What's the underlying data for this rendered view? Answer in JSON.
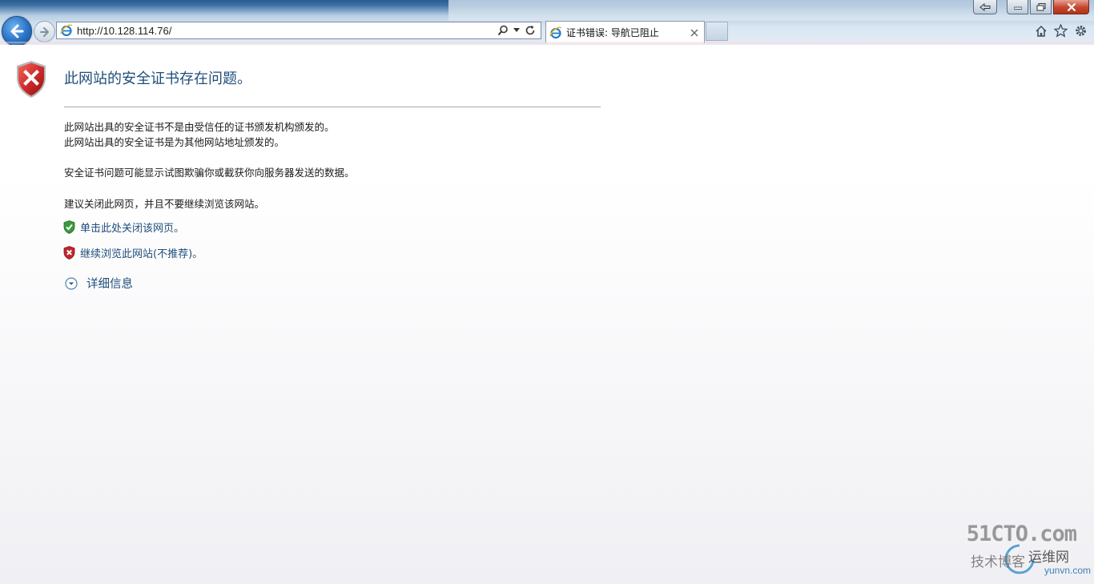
{
  "browser": {
    "address_bar": {
      "url": "http://10.128.114.76/"
    },
    "tab": {
      "title": "证书错误: 导航已阻止"
    },
    "icons": [
      "back-icon",
      "forward-icon",
      "ie-logo-icon",
      "search-icon",
      "dropdown-icon",
      "refresh-icon",
      "close-icon",
      "home-icon",
      "favorites-star-icon",
      "tools-gear-icon"
    ]
  },
  "page": {
    "title": "此网站的安全证书存在问题。",
    "reasons": [
      "此网站出具的安全证书不是由受信任的证书颁发机构颁发的。",
      "此网站出具的安全证书是为其他网站地址颁发的。"
    ],
    "warning": "安全证书问题可能显示试图欺骗你或截获你向服务器发送的数据。",
    "recommendation": "建议关闭此网页，并且不要继续浏览该网站。",
    "actions": {
      "close_page": "单击此处关闭该网页。",
      "continue": "继续浏览此网站(不推荐)。"
    },
    "details": "详细信息"
  },
  "watermark": {
    "brand": "51CTO.com",
    "sub_left": "技术博客",
    "sub_right": "运维网",
    "domain": "yunvn.com"
  },
  "colors": {
    "link": "#1f4e7a",
    "error_shield": "#c0262b",
    "safe_shield": "#3a9a3a"
  }
}
